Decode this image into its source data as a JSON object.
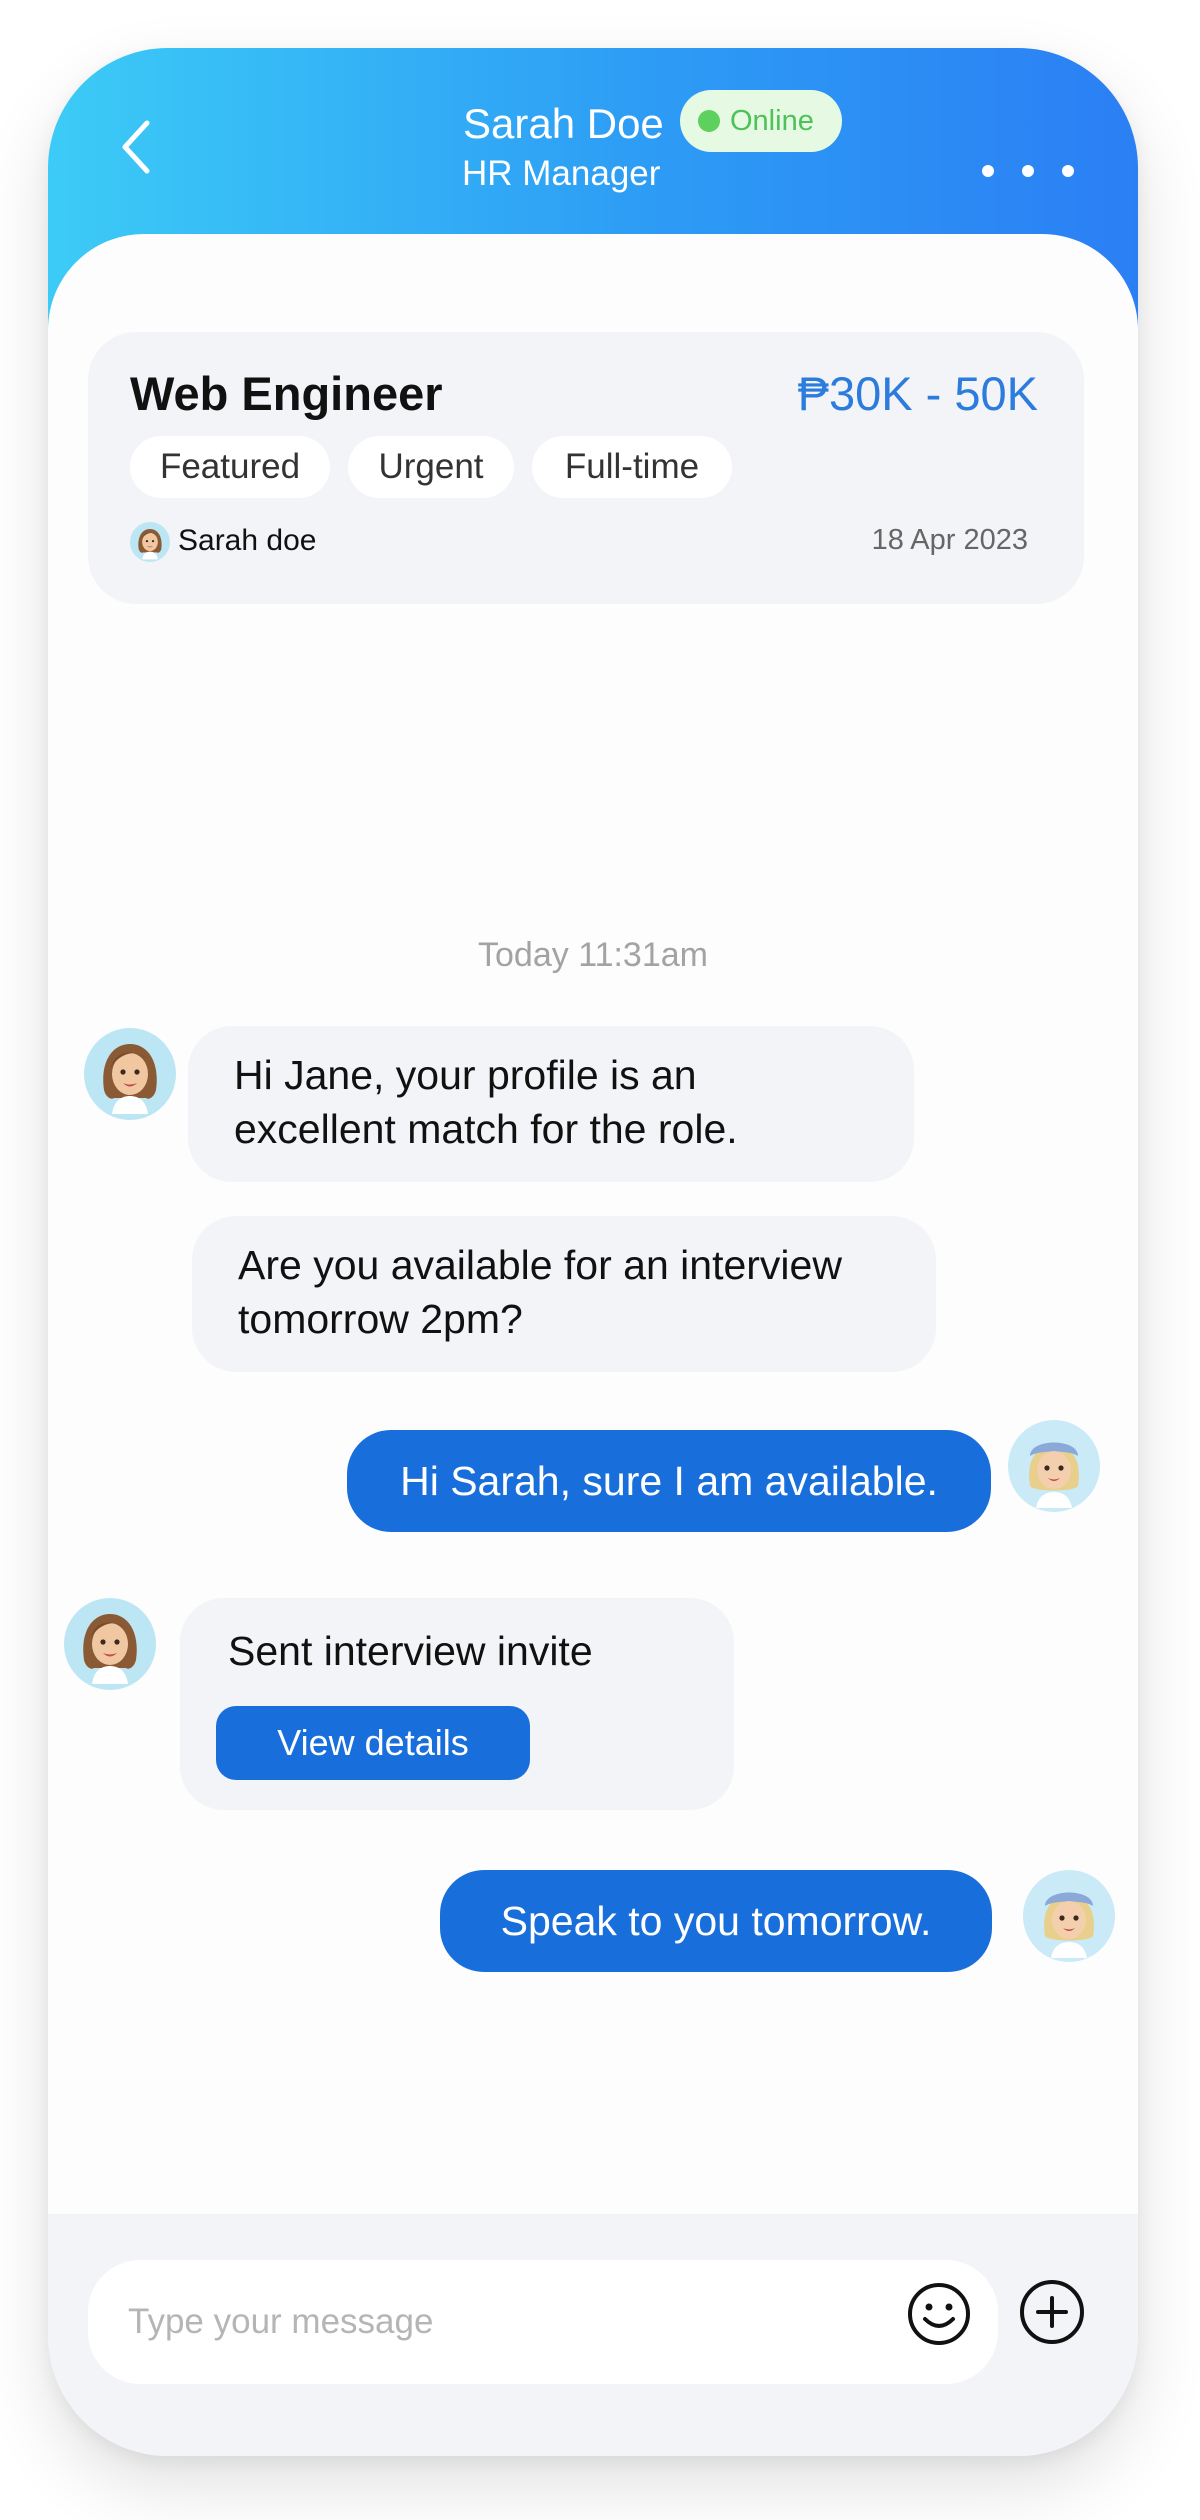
{
  "header": {
    "contact_name": "Sarah Doe",
    "status": "Online",
    "role": "HR Manager"
  },
  "job_card": {
    "title": "Web Engineer",
    "salary": "₱30K - 50K",
    "tags": [
      "Featured",
      "Urgent",
      "Full-time"
    ],
    "poster": "Sarah doe",
    "date": "18 Apr 2023"
  },
  "chat": {
    "timestamp": "Today 11:31am",
    "messages": [
      {
        "from": "them",
        "text": "Hi Jane, your profile is an excellent match for the role."
      },
      {
        "from": "them",
        "text": "Are you available for an interview tomorrow 2pm?"
      },
      {
        "from": "me",
        "text": "Hi Sarah, sure I am available."
      },
      {
        "from": "them",
        "text": "Sent interview invite",
        "button": "View details"
      },
      {
        "from": "me",
        "text": "Speak to you tomorrow."
      }
    ]
  },
  "composer": {
    "placeholder": "Type your message"
  },
  "icons": {
    "back": "chevron-left-icon",
    "more": "more-horizontal-icon",
    "emoji": "smiley-icon",
    "add": "plus-circle-icon"
  },
  "colors": {
    "header_gradient_start": "#3ccbf6",
    "header_gradient_end": "#2b7ff4",
    "accent": "#186fdb",
    "salary": "#2b7cdc",
    "online": "#5dd05e",
    "bubble_incoming": "#f3f4f7"
  }
}
